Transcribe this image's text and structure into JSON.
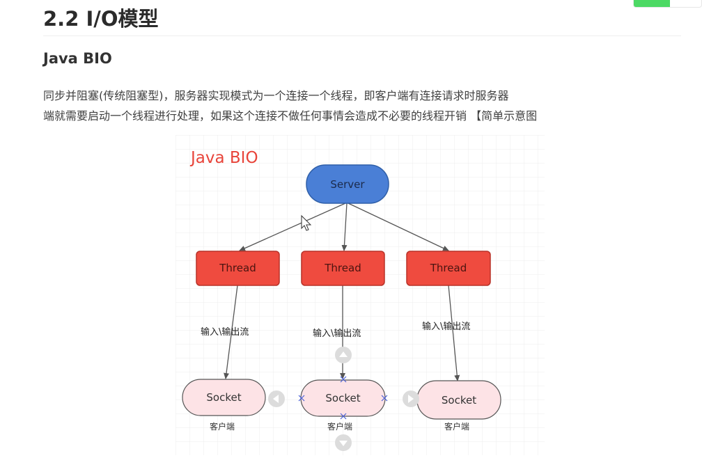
{
  "page": {
    "section_title": "2.2 I/O模型",
    "subsection_title": "Java BIO",
    "paragraph_lines": [
      "同步并阻塞(传统阻塞型)，服务器实现模式为一个连接一个线程，即客户端有连接请求时服务器",
      "端就需要启动一个线程进行处理，如果这个连接不做任何事情会造成不必要的线程开销 【简单示意图"
    ]
  },
  "diagram": {
    "title": "Java BIO",
    "server_label": "Server",
    "threads": [
      "Thread",
      "Thread",
      "Thread"
    ],
    "edge_labels": [
      "输入\\输出流",
      "输入\\输出流",
      "输入\\输出流"
    ],
    "sockets": [
      "Socket",
      "Socket",
      "Socket"
    ],
    "socket_captions": [
      "客户端",
      "客户端",
      "客户端"
    ]
  },
  "colors": {
    "server_fill": "#4a7fd6",
    "thread_fill": "#ef4b3f",
    "socket_fill": "#fde3e6",
    "diagram_title": "#e8443a",
    "grid": "#ececec"
  }
}
